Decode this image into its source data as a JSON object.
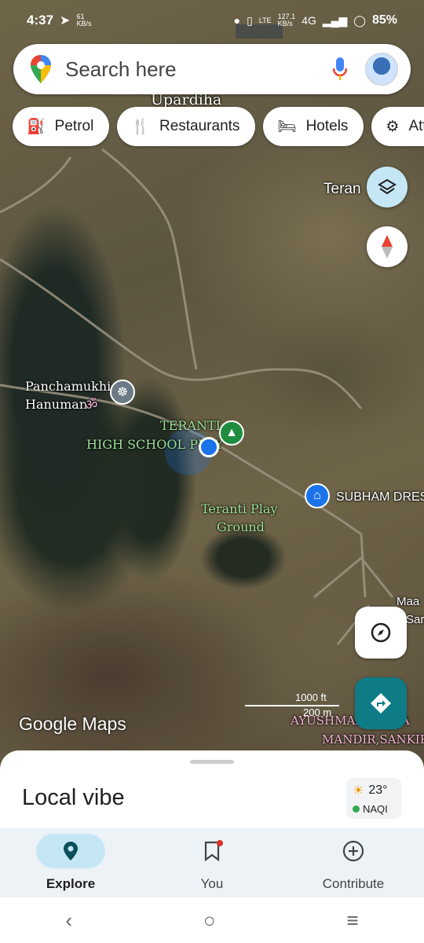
{
  "status_bar": {
    "time": "4:37",
    "net_speed": "61\nKB/s",
    "lte_speed": "127.1\nKB/s",
    "network": "4G",
    "battery": "85%"
  },
  "search": {
    "placeholder": "Search here"
  },
  "chips": [
    {
      "label": "Petrol",
      "icon": "fuel-icon"
    },
    {
      "label": "Restaurants",
      "icon": "restaurant-icon"
    },
    {
      "label": "Hotels",
      "icon": "hotel-icon"
    },
    {
      "label": "Att",
      "icon": "attraction-icon"
    }
  ],
  "map_labels": {
    "upardiha": "Upardiha",
    "teran": "Teran",
    "panchamukhi_1": "Panchamukhi",
    "panchamukhi_2": "Hanuman",
    "teranti_school_1": "TERANTI",
    "teranti_school_2": "HIGH SCHOOL PLAY",
    "subham": "SUBHAM DRES",
    "teranti_play_1": "Teranti Play",
    "teranti_play_2": "Ground",
    "maa_1": "Maa",
    "maa_2": "Sar",
    "ayush_1": "AYUSHMAN",
    "ayush_2": "MANDIR,SANKIR",
    "ayush_suffix": "YA"
  },
  "scale": {
    "ft": "1000 ft",
    "m": "200 m"
  },
  "branding": {
    "logo": "Google Maps"
  },
  "sheet": {
    "title": "Local vibe",
    "temperature": "23°",
    "aqi_label": "NAQI"
  },
  "bottom_nav": [
    {
      "label": "Explore",
      "icon": "explore-pin-icon",
      "active": true
    },
    {
      "label": "You",
      "icon": "bookmark-icon",
      "active": false
    },
    {
      "label": "Contribute",
      "icon": "add-circle-icon",
      "active": false
    }
  ],
  "colors": {
    "primary_blue": "#1a73e8",
    "location_dot": "#1a73e8",
    "explore_pill": "#c5e7f5",
    "directions_fab": "#0e7c86"
  }
}
